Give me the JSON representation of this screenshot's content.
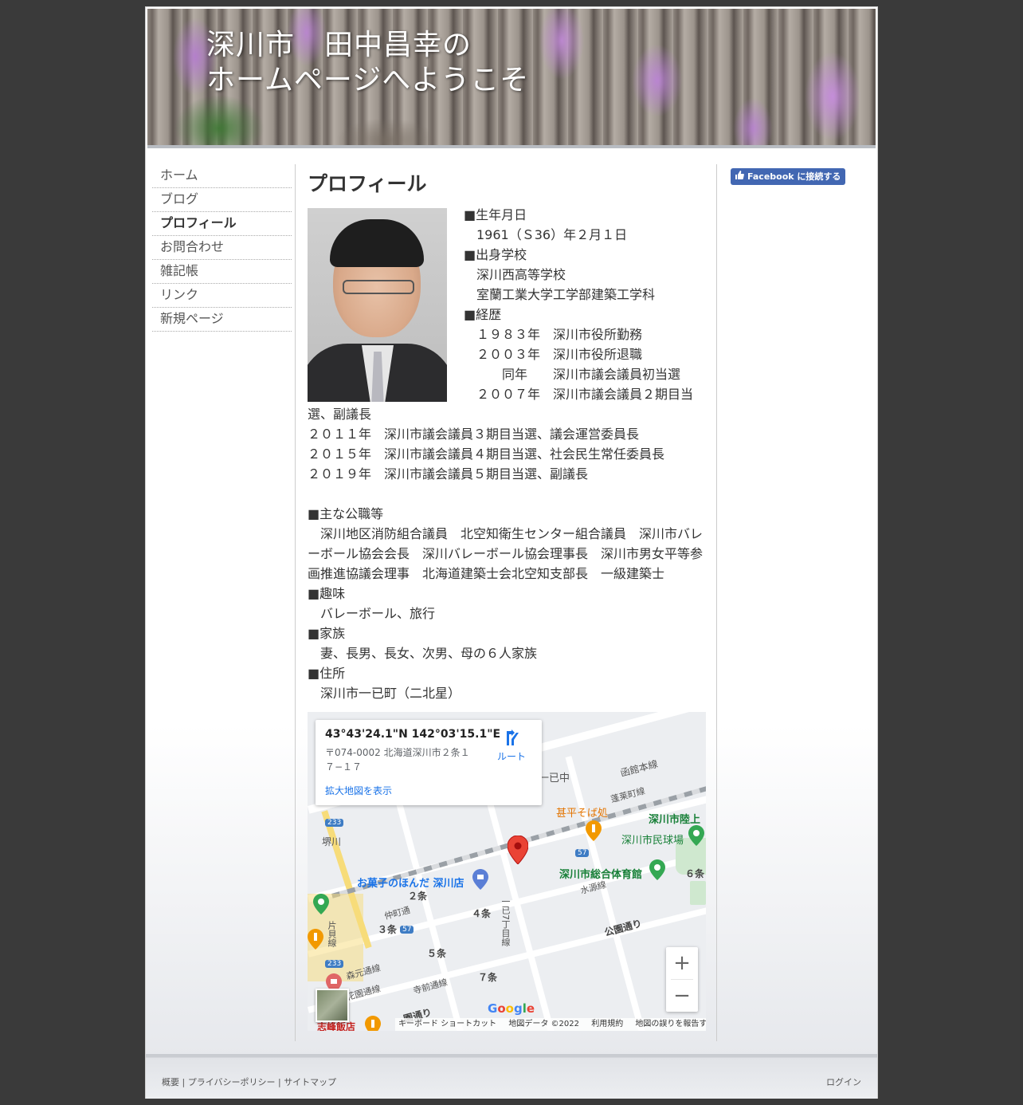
{
  "header": {
    "title_line1": "深川市　田中昌幸の",
    "title_line2": "ホームページへようこそ"
  },
  "nav": {
    "items": [
      {
        "label": "ホーム"
      },
      {
        "label": "ブログ"
      },
      {
        "label": "プロフィール",
        "active": true
      },
      {
        "label": "お問合わせ"
      },
      {
        "label": "雑記帳"
      },
      {
        "label": "リンク"
      },
      {
        "label": "新規ページ"
      }
    ]
  },
  "main": {
    "title": "プロフィール",
    "lines": [
      "■生年月日",
      "　1961（Ｓ36）年２月１日",
      "■出身学校",
      "　深川西高等学校",
      "　室蘭工業大学工学部建築工学科",
      "■経歴",
      "　１９８３年　深川市役所勤務",
      "　２００３年　深川市役所退職",
      "　　　同年　　深川市議会議員初当選",
      "　２００７年　深川市議会議員２期目当選、副議長",
      "２０１１年　深川市議会議員３期目当選、議会運営委員長",
      "２０１５年　深川市議会議員４期目当選、社会民生常任委員長",
      "２０１９年　深川市議会議員５期目当選、副議長",
      "",
      "■主な公職等",
      "　深川地区消防組合議員　北空知衛生センター組合議員　深川市バレーボール協会会長　深川バレーボール協会理事長　深川市男女平等参画推進協議会理事　北海道建築士会北空知支部長　一級建築士",
      "■趣味",
      "　バレーボール、旅行",
      "■家族",
      "　妻、長男、長女、次男、母の６人家族",
      "■住所",
      "　深川市一已町（二北星）"
    ]
  },
  "map": {
    "coord": "43°43'24.1\"N 142°03'15.1\"E",
    "address": "〒074-0002 北海道深川市２条１７−１７",
    "larger_map": "拡大地図を表示",
    "route": "ルート",
    "labels": {
      "hakodate": "函館本線",
      "horai": "蓬莱町線",
      "ichiyan": "一已中",
      "soba": "甚平そば処",
      "rikujo": "深川市陸上",
      "minkyu": "深川市民球場",
      "taiikukan": "深川市総合体育館",
      "suigen": "水源線",
      "okashi": "お菓子のほんだ 深川店",
      "jo2": "２条",
      "jo3": "３条",
      "jo4": "４条",
      "jo5": "５条",
      "jo6": "６条",
      "jo7": "７条",
      "naka": "仲町通",
      "koen": "公園通り",
      "ichiyan7": "一已7丁目線",
      "morimoto": "森元通線",
      "hanazono": "花園通線",
      "teramae": "寺前通線",
      "gobo": "堺川",
      "shiho": "志峰飯店",
      "n233": "233",
      "n57": "57",
      "n57b": "57",
      "n233b": "233",
      "kita": "片貝線",
      "kuen": "園通り"
    },
    "zoom_in": "+",
    "zoom_out": "−",
    "google": "Google",
    "footer": {
      "keyboard": "キーボード ショートカット",
      "data": "地図データ ©2022",
      "terms": "利用規約",
      "report": "地図の誤りを報告する"
    }
  },
  "facebook": {
    "label": "Facebook に接続する"
  },
  "footer": {
    "about": "概要",
    "sep": " | ",
    "privacy": "プライバシーポリシー",
    "sitemap": "サイトマップ",
    "login": "ログイン"
  },
  "colors": {
    "background": "#3a3a3a",
    "facebook": "#4267b2",
    "map_pin": "#ea4335",
    "link_blue": "#1a73e8"
  }
}
